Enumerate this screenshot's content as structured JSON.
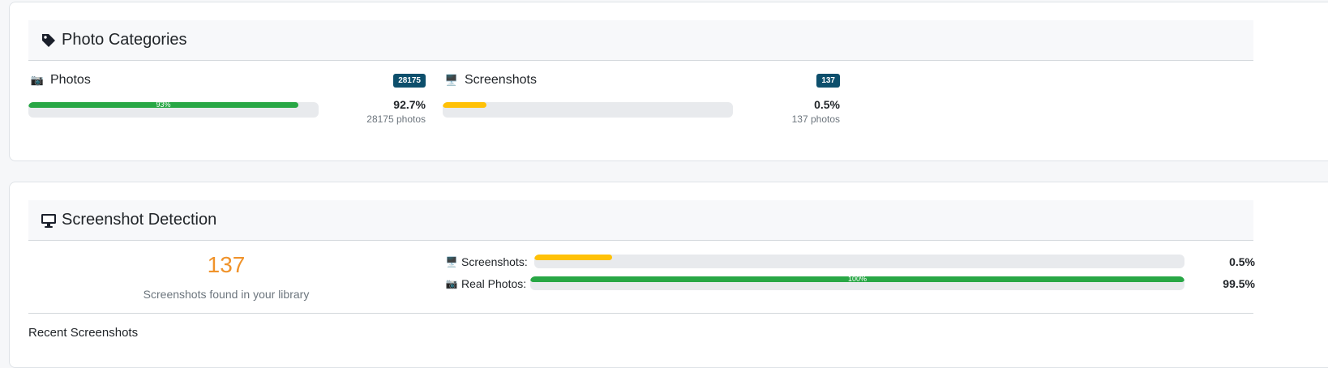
{
  "categories_card": {
    "title": "Photo Categories",
    "icon": "tag-icon",
    "items": [
      {
        "emoji": "📷",
        "label": "Photos",
        "badge": "28175",
        "percent": "92.7%",
        "count": "28175 photos",
        "bar_fraction": 0.93,
        "bar_text": "93%",
        "bar_color": "#28a745"
      },
      {
        "emoji": "🖥️",
        "label": "Screenshots",
        "badge": "137",
        "percent": "0.5%",
        "count": "137 photos",
        "bar_fraction": 0.15,
        "bar_text": "",
        "bar_color": "#ffc107"
      }
    ]
  },
  "detection_card": {
    "title": "Screenshot Detection",
    "icon": "desktop-icon",
    "count": "137",
    "count_caption": "Screenshots found in your library",
    "rows": [
      {
        "emoji": "🖥️",
        "label": "Screenshots:",
        "percent": "0.5%",
        "bar_fraction": 0.12,
        "bar_text": "",
        "bar_color": "#ffc107"
      },
      {
        "emoji": "📷",
        "label": "Real Photos:",
        "percent": "99.5%",
        "bar_fraction": 1.0,
        "bar_text": "100%",
        "bar_color": "#28a745"
      }
    ],
    "recent_title": "Recent Screenshots"
  },
  "colors": {
    "badge": "#0d4f6c",
    "count_accent": "#f0932b"
  }
}
